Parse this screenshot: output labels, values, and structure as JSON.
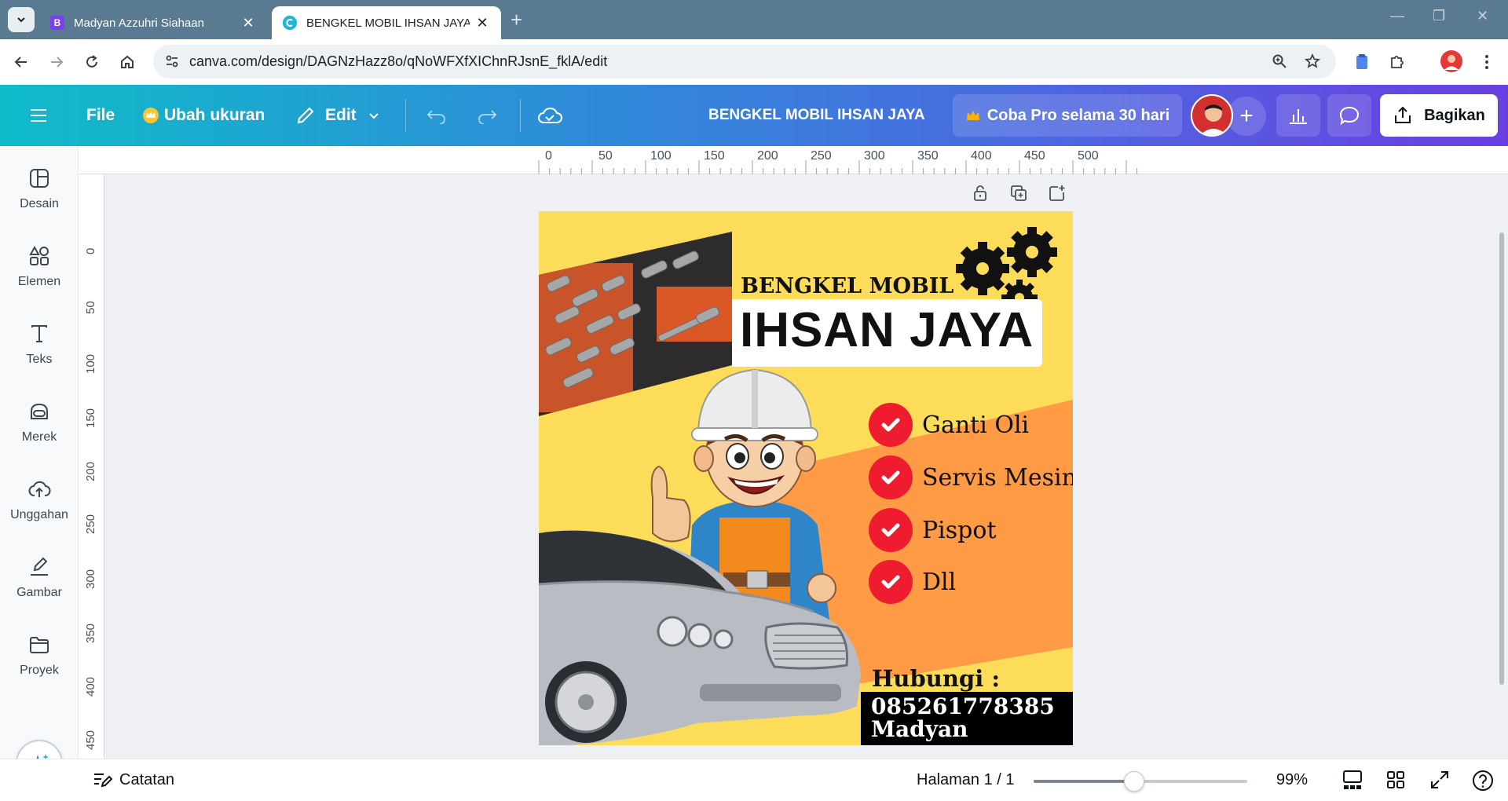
{
  "browser": {
    "tabs": [
      {
        "title": "Madyan Azzuhri Siahaan",
        "favicon_letter": "B",
        "active": false
      },
      {
        "title": "BENGKEL MOBIL IHSAN JAYA - ",
        "active": true
      }
    ],
    "url": "canva.com/design/DAGNzHazz8o/qNoWFXfXIChnRJsnE_fklA/edit"
  },
  "toolbar": {
    "file_label": "File",
    "resize_label": "Ubah ukuran",
    "edit_label": "Edit",
    "doc_title": "BENGKEL MOBIL IHSAN JAYA",
    "pro_label": "Coba Pro selama 30 hari",
    "share_label": "Bagikan"
  },
  "sidebar": {
    "items": [
      {
        "label": "Desain",
        "icon": "design-icon"
      },
      {
        "label": "Elemen",
        "icon": "elements-icon"
      },
      {
        "label": "Teks",
        "icon": "text-icon"
      },
      {
        "label": "Merek",
        "icon": "brand-icon"
      },
      {
        "label": "Unggahan",
        "icon": "upload-icon"
      },
      {
        "label": "Gambar",
        "icon": "draw-icon"
      },
      {
        "label": "Proyek",
        "icon": "folder-icon"
      }
    ]
  },
  "rulers": {
    "top": [
      "0",
      "50",
      "100",
      "150",
      "200",
      "250",
      "300",
      "350",
      "400",
      "450",
      "500"
    ],
    "left": [
      "0",
      "50",
      "100",
      "150",
      "200",
      "250",
      "300",
      "350",
      "400",
      "450",
      "0"
    ]
  },
  "design": {
    "brand_top": "BENGKEL MOBIL",
    "brand_main": "IHSAN JAYA",
    "services": [
      "Ganti Oli",
      "Servis Mesin",
      "Pispot",
      "Dll"
    ],
    "contact_label": "Hubungi :",
    "phone": "085261778385",
    "contact_name": "Madyan",
    "colors": {
      "background": "#fddc5a",
      "orange_band": "#ff9a45",
      "check": "#ee1c2e",
      "text": "#111111"
    }
  },
  "status": {
    "notes_label": "Catatan",
    "page_indicator": "Halaman 1 / 1",
    "zoom_label": "99%",
    "zoom_fraction": 0.47
  }
}
